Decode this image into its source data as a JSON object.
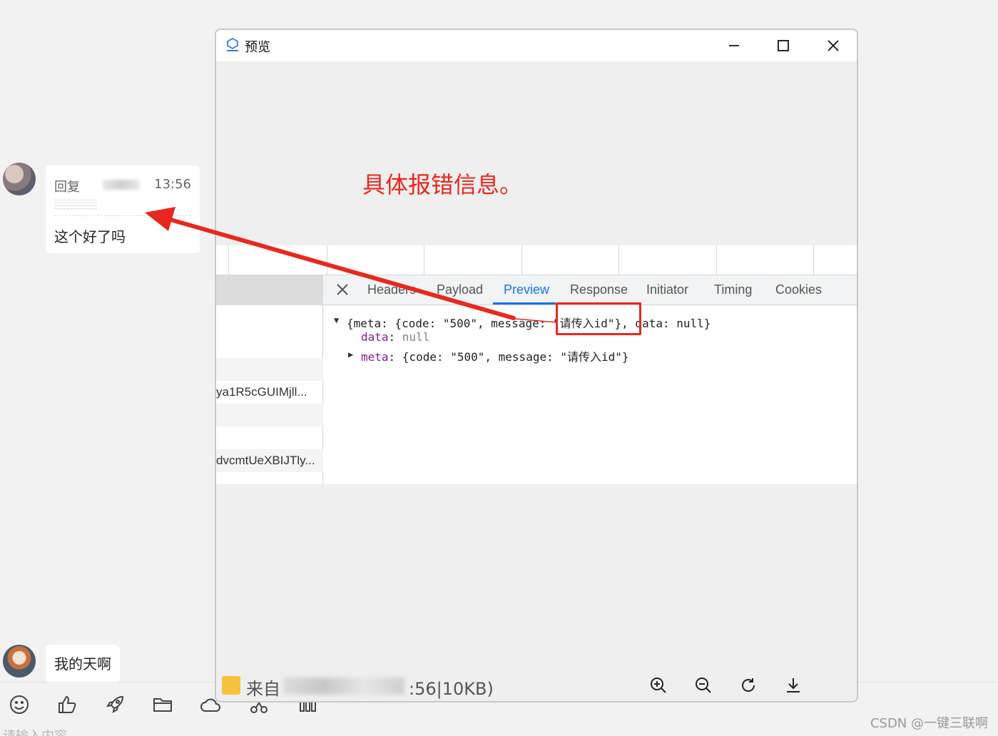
{
  "chat": {
    "reply": {
      "head": "回复",
      "time": "13:56",
      "text": "这个好了吗"
    },
    "message2": "我的天啊",
    "input_placeholder": "请输入内容",
    "toolbar_icons": [
      "emoji-icon",
      "thumbs-up-icon",
      "rocket-icon",
      "folder-icon",
      "cloud-icon",
      "scissors-icon",
      "chart-icon"
    ]
  },
  "preview_window": {
    "title": "预览",
    "annotation": "具体报错信息。",
    "devtools": {
      "tabs": [
        "Headers",
        "Payload",
        "Preview",
        "Response",
        "Initiator",
        "Timing",
        "Cookies"
      ],
      "active_tab": "Preview",
      "requests": [
        "ya1R5cGUIMjll...",
        "dvcmtUeXBIJTly..."
      ],
      "json_lines": {
        "line1_a": "{meta: {code: \"500\", message: ",
        "line1_b": "\"请传入id\"",
        "line1_c": "}, data: null}",
        "line2_key": "data",
        "line2_val": "null",
        "line3_key": "meta",
        "line3_val": "{code: \"500\", message: \"请传入id\"}"
      }
    },
    "footer": {
      "file_info_prefix": "来自",
      "file_info_suffix": ":56|10KB)"
    }
  },
  "watermark": "CSDN @一键三联啊",
  "colors": {
    "annotation": "#e8281e",
    "active_tab": "#1a73e8",
    "background": "#f2f2f3"
  }
}
